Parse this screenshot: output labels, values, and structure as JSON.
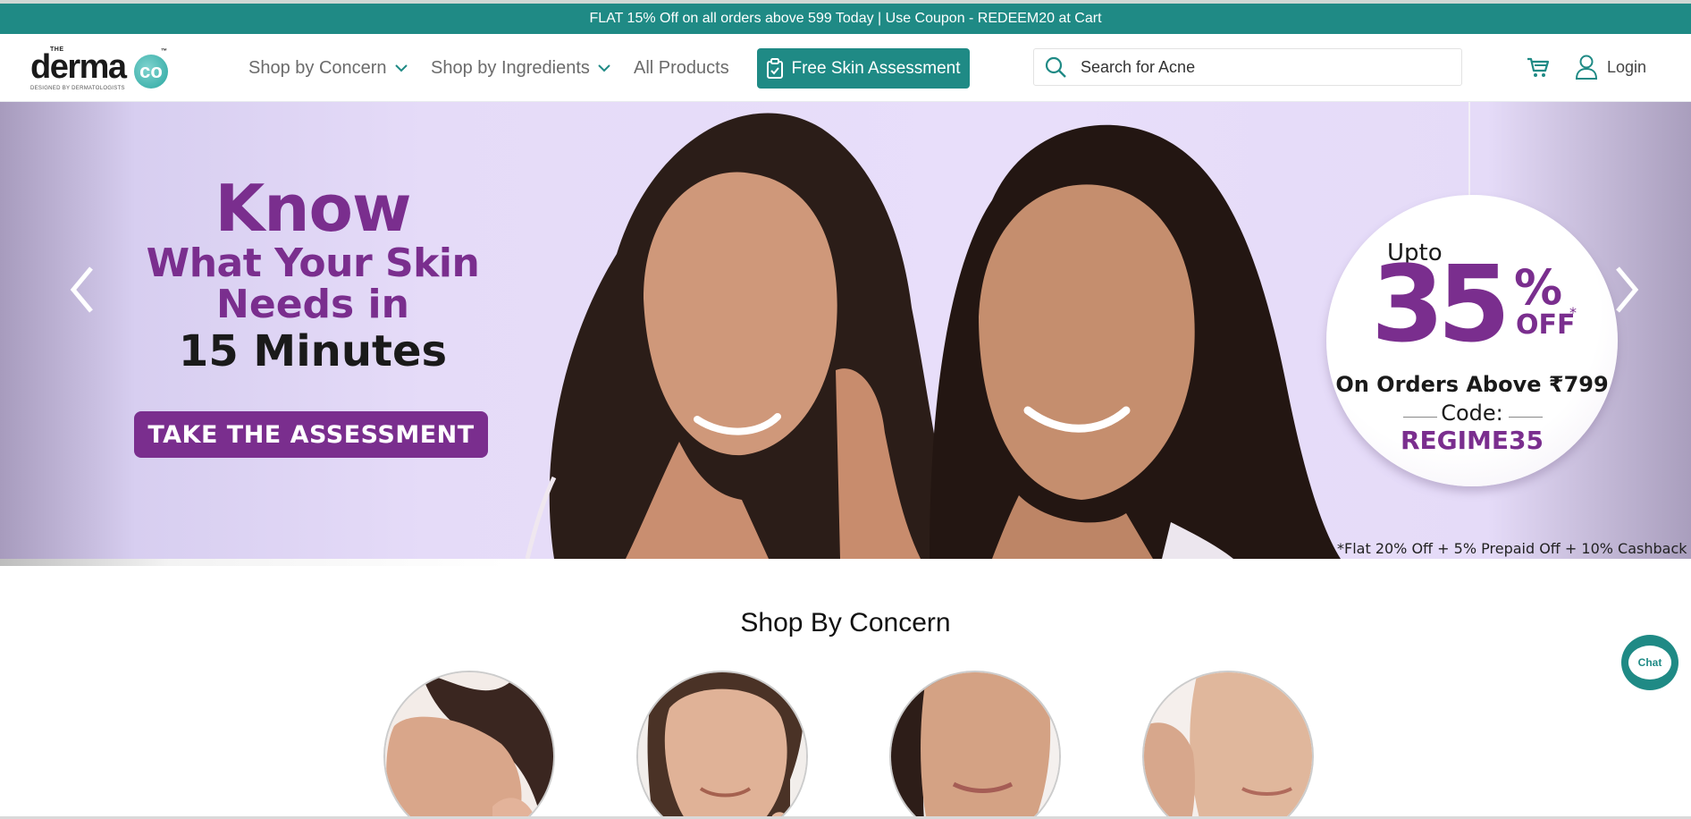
{
  "promo": {
    "text": "FLAT 15% Off on all orders above 599 Today | Use Coupon - REDEEM20 at Cart"
  },
  "logo": {
    "the": "THE",
    "word": "derma",
    "co": "co",
    "tm": "™",
    "tagline": "DESIGNED BY DERMATOLOGISTS"
  },
  "nav": {
    "concern": "Shop by Concern",
    "ingredients": "Shop by Ingredients",
    "all": "All Products"
  },
  "assessment_button": "Free Skin Assessment",
  "search": {
    "placeholder": "Search for Acne"
  },
  "login": "Login",
  "hero": {
    "line1": "Know",
    "line2": "What Your Skin",
    "line3": "Needs in",
    "line4": "15 Minutes",
    "cta": "TAKE THE ASSESSMENT",
    "offer": {
      "upto": "Upto",
      "value": "35",
      "percent": "%",
      "off": "OFF",
      "star": "*",
      "above": "On Orders Above ₹799",
      "code_label": "Code:",
      "code": "REGIME35"
    },
    "disclaimer": "*Flat 20% Off + 5% Prepaid Off + 10% Cashback"
  },
  "shop_by_concern": {
    "title": "Shop By Concern"
  },
  "chat": {
    "label": "Chat"
  },
  "colors": {
    "brand_teal": "#1f8a85",
    "brand_purple": "#7a2e8e",
    "hero_bg": "#e8defa"
  }
}
